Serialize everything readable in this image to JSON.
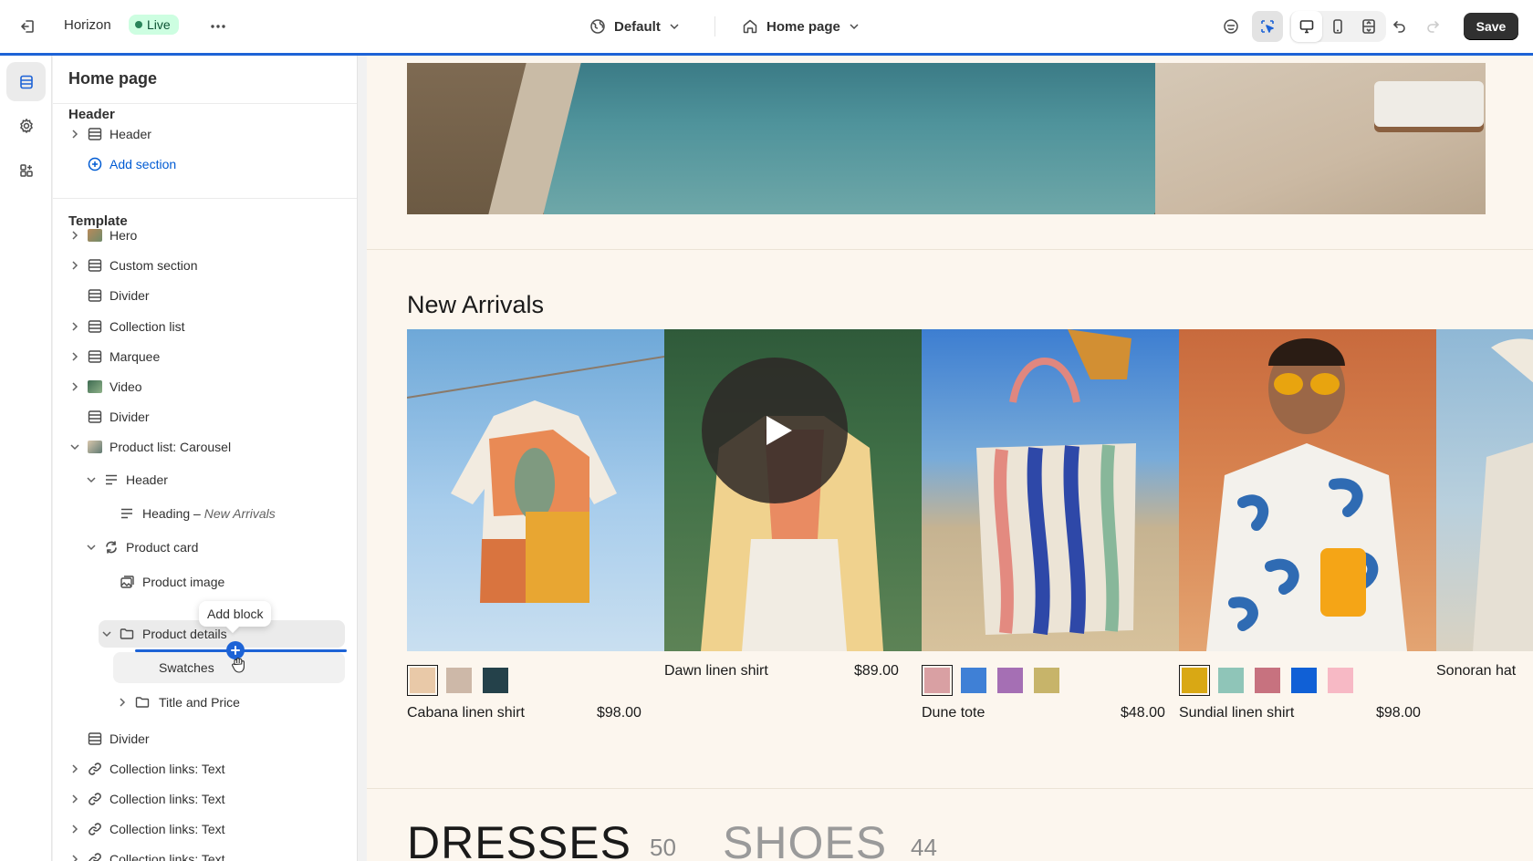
{
  "topbar": {
    "store_name": "Horizon",
    "live_label": "Live",
    "theme_select": "Default",
    "page_select": "Home page",
    "save_label": "Save"
  },
  "sidebar": {
    "title": "Home page",
    "header_group": "Header",
    "header_item": "Header",
    "add_section": "Add section",
    "template_group": "Template",
    "items": {
      "hero": "Hero",
      "custom_section": "Custom section",
      "divider_1": "Divider",
      "collection_list": "Collection list",
      "marquee": "Marquee",
      "video": "Video",
      "divider_2": "Divider",
      "product_list": "Product list: Carousel",
      "header_block": "Header",
      "heading": "Heading",
      "heading_sep": " – ",
      "heading_sub": "New Arrivals",
      "product_card": "Product card",
      "product_image": "Product image",
      "product_details": "Product details",
      "swatches": "Swatches",
      "title_and_price": "Title and Price",
      "divider_3": "Divider",
      "collection_links_1": "Collection links: Text",
      "collection_links_2": "Collection links: Text",
      "collection_links_3": "Collection links: Text",
      "collection_links_4": "Collection links: Text"
    },
    "tooltip": "Add block"
  },
  "preview": {
    "section_title": "New Arrivals",
    "products": [
      {
        "name": "Cabana linen shirt",
        "price": "$98.00",
        "swatches": [
          "#e9c9a8",
          "#cdb8a8",
          "#24414a"
        ]
      },
      {
        "name": "Dawn linen shirt",
        "price": "$89.00",
        "swatches": []
      },
      {
        "name": "Dune tote",
        "price": "$48.00",
        "swatches": [
          "#d9a0a3",
          "#3f80d6",
          "#a56fb4",
          "#c7b46a"
        ]
      },
      {
        "name": "Sundial linen shirt",
        "price": "$98.00",
        "swatches": [
          "#d9a814",
          "#8fc5b8",
          "#c7727f",
          "#1060d6",
          "#f7b9c5"
        ]
      },
      {
        "name": "Sonoran hat",
        "price": "",
        "swatches": []
      }
    ],
    "collections": [
      {
        "name": "DRESSES",
        "count": "50"
      },
      {
        "name": "SHOES",
        "count": "44"
      }
    ]
  },
  "colors": {
    "accent_blue": "#1d63d6",
    "live_bg": "#cdfee1",
    "save_bg": "#303030",
    "page_bg": "#fcf6ee"
  }
}
